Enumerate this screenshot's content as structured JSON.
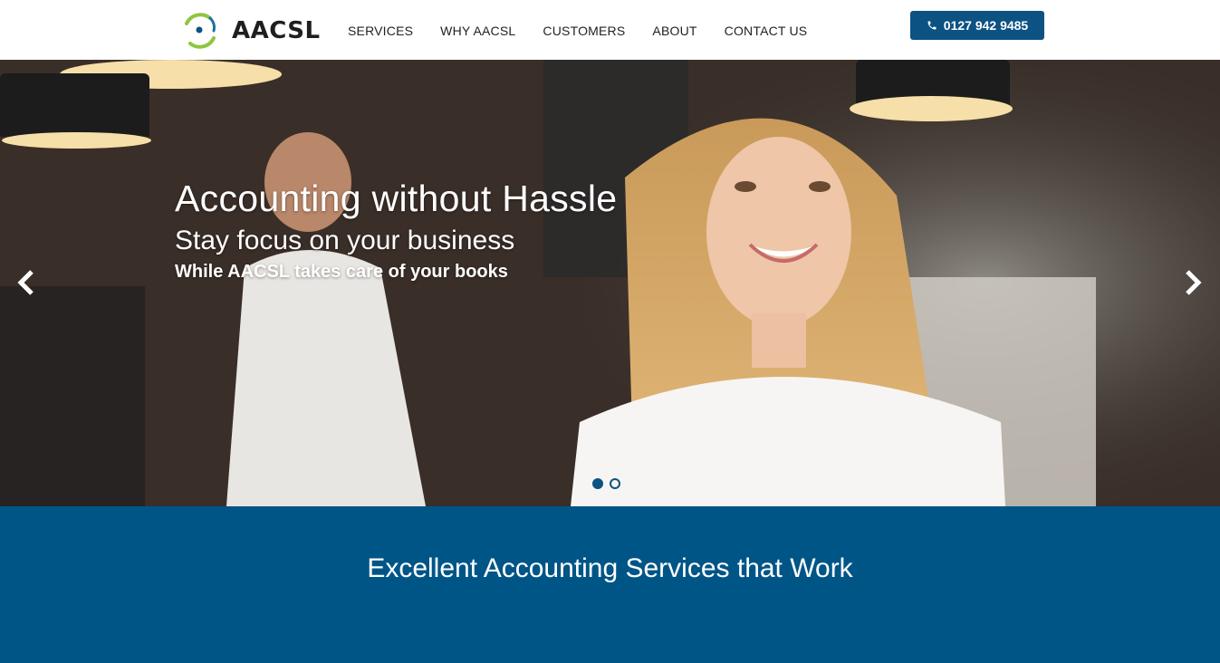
{
  "brand": {
    "name": "AACSL",
    "accent": "#0c5282"
  },
  "nav": {
    "items": [
      {
        "label": "SERVICES"
      },
      {
        "label": "WHY AACSL"
      },
      {
        "label": "CUSTOMERS"
      },
      {
        "label": "ABOUT"
      },
      {
        "label": "CONTACT US"
      }
    ]
  },
  "phone": {
    "icon": "phone-icon",
    "label": "0127 942 9485"
  },
  "hero": {
    "headline": "Accounting without Hassle",
    "subheadline": "Stay focus on your business",
    "tagline": "While AACSL takes care of your books",
    "slides": {
      "count": 2,
      "active": 1
    },
    "prev_icon": "chevron-left-icon",
    "next_icon": "chevron-right-icon"
  },
  "band": {
    "title": "Excellent Accounting Services that Work",
    "color": "#005587"
  }
}
